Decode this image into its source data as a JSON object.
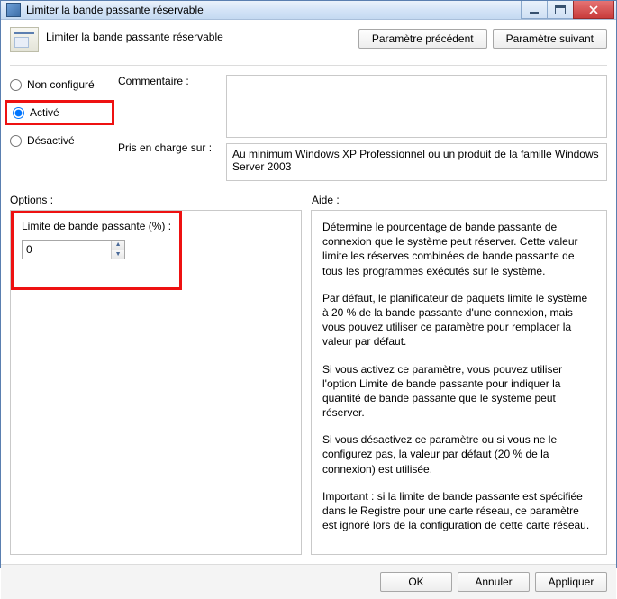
{
  "window": {
    "title": "Limiter la bande passante réservable"
  },
  "header": {
    "title": "Limiter la bande passante réservable"
  },
  "nav": {
    "prev": "Paramètre précédent",
    "next": "Paramètre suivant"
  },
  "radios": {
    "not_configured": "Non configuré",
    "enabled": "Activé",
    "disabled": "Désactivé",
    "selected": "enabled"
  },
  "labels": {
    "comment": "Commentaire :",
    "supported": "Pris en charge sur :",
    "options": "Options :",
    "help": "Aide :"
  },
  "supported_text": "Au minimum Windows XP Professionnel ou un produit de la famille Windows Server 2003",
  "options": {
    "limit_label": "Limite de bande passante (%) :",
    "limit_value": "0"
  },
  "help": {
    "p1": "Détermine le pourcentage de bande passante de connexion que le système peut réserver. Cette valeur limite les réserves combinées de bande passante de tous les programmes exécutés sur le système.",
    "p2": "Par défaut, le planificateur de paquets limite le système à 20 % de la bande passante d'une connexion, mais vous pouvez utiliser ce paramètre pour remplacer la valeur par défaut.",
    "p3": "Si vous activez ce paramètre, vous pouvez utiliser l'option Limite de bande passante pour indiquer la quantité de bande passante que le système peut réserver.",
    "p4": "Si vous désactivez ce paramètre ou si vous ne le configurez pas, la valeur par défaut (20 % de la connexion) est utilisée.",
    "p5": "Important : si la limite de bande passante est spécifiée dans le Registre pour une carte réseau, ce paramètre est ignoré lors de la configuration de cette carte réseau."
  },
  "footer": {
    "ok": "OK",
    "cancel": "Annuler",
    "apply": "Appliquer"
  }
}
